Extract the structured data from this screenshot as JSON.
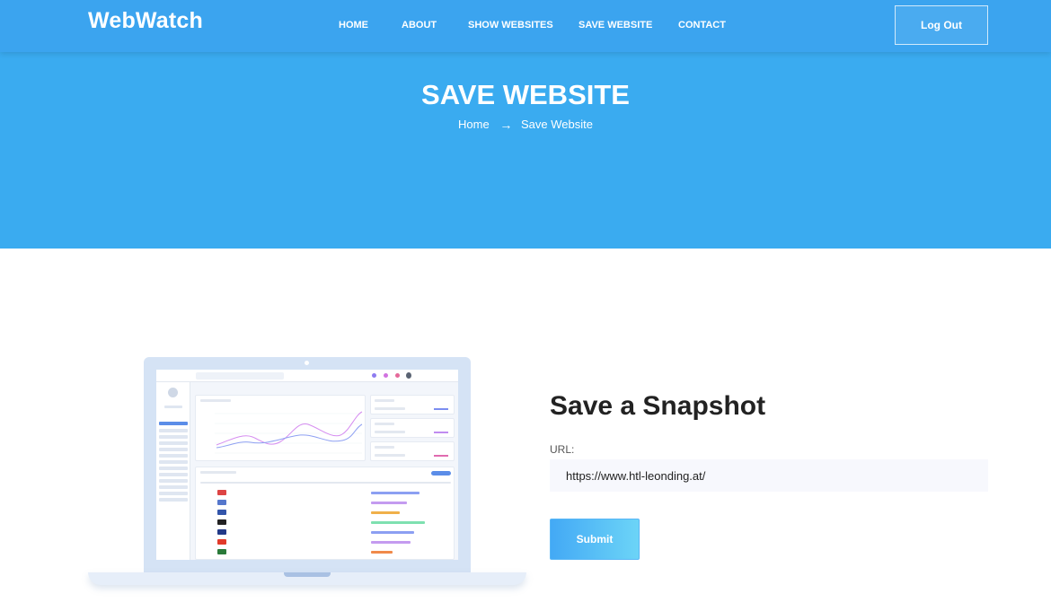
{
  "brand": "WebWatch",
  "nav": {
    "items": [
      {
        "label": "HOME"
      },
      {
        "label": "ABOUT"
      },
      {
        "label": "SHOW WEBSITES"
      },
      {
        "label": "SAVE WEBSITE"
      },
      {
        "label": "CONTACT"
      }
    ],
    "logout_label": "Log Out"
  },
  "hero": {
    "title": "SAVE WEBSITE",
    "breadcrumb": {
      "home": "Home",
      "arrow": "→",
      "current": "Save Website"
    }
  },
  "form": {
    "title": "Save a Snapshot",
    "url_label": "URL:",
    "url_value": "https://www.htl-leonding.at/",
    "submit_label": "Submit"
  },
  "colors": {
    "header": "#3ba4ef",
    "hero": "#3aabf0",
    "accent": "#43a9f5"
  },
  "icons": {
    "breadcrumb_arrow": "arrow-right-icon",
    "illustration": "laptop-dashboard-illustration"
  }
}
